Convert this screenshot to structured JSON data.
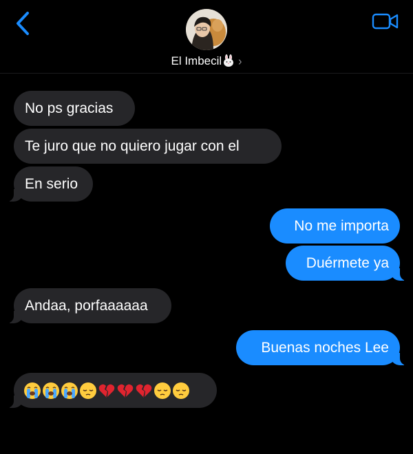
{
  "header": {
    "contact_name": "El Imbecil",
    "back_icon": "chevron-left-icon",
    "video_icon": "video-camera-icon",
    "accent_color": "#1a8cff"
  },
  "messages": [
    {
      "direction": "incoming",
      "text": "No ps gracias"
    },
    {
      "direction": "incoming",
      "text": "Te juro que no quiero jugar con el"
    },
    {
      "direction": "incoming",
      "text": "En serio"
    },
    {
      "direction": "outgoing",
      "text": "No me importa"
    },
    {
      "direction": "outgoing",
      "text": "Duérmete ya"
    },
    {
      "direction": "incoming",
      "text": "Andaa, porfaaaaaa"
    },
    {
      "direction": "outgoing",
      "text": "Buenas noches Lee"
    },
    {
      "direction": "incoming",
      "text": "😭😭😭😔💔💔💔😔😔",
      "emoji": [
        "loudly-crying-face",
        "loudly-crying-face",
        "loudly-crying-face",
        "pensive-face",
        "broken-heart",
        "broken-heart",
        "broken-heart",
        "pensive-face",
        "pensive-face"
      ]
    }
  ],
  "colors": {
    "background": "#000000",
    "incoming_bubble": "#262629",
    "outgoing_bubble": "#1a8cff"
  }
}
